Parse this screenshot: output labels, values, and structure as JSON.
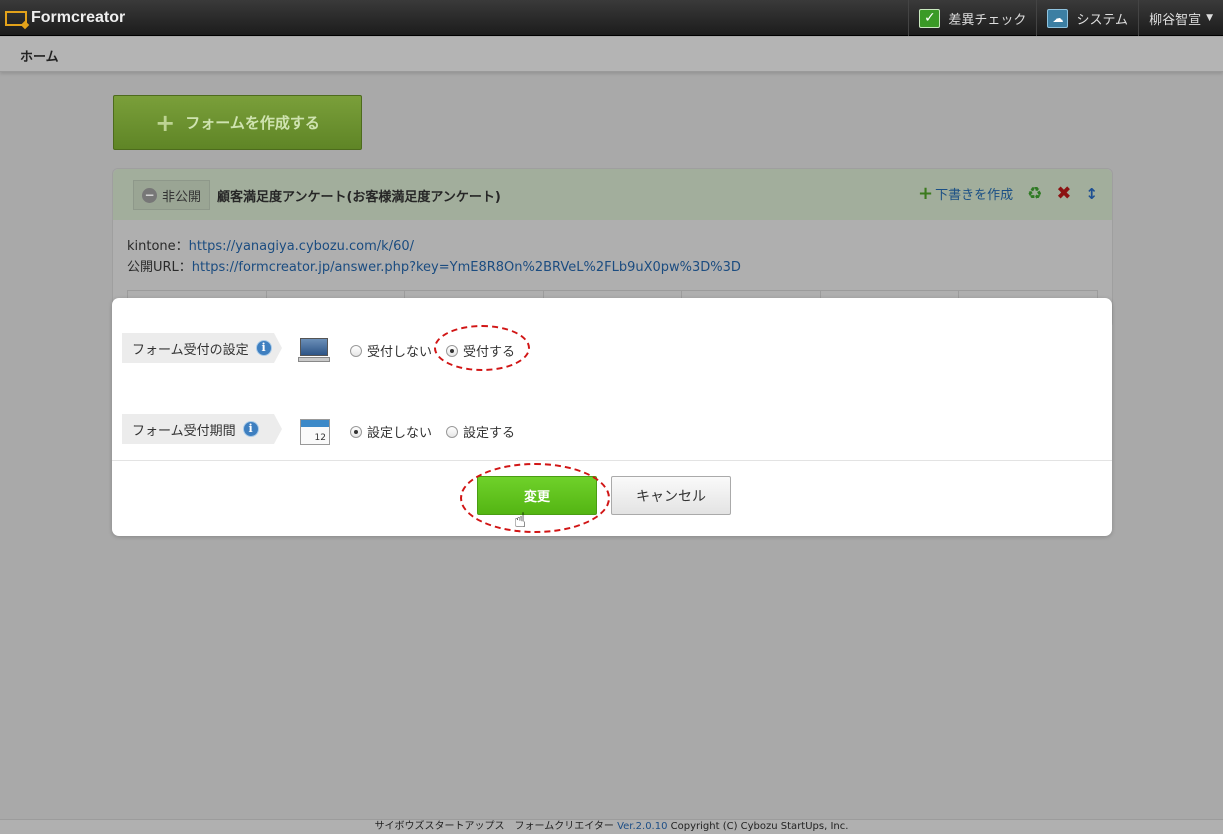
{
  "app": {
    "title": "Formcreator",
    "nav": {
      "diff_check": "差異チェック",
      "system": "システム",
      "user": "柳谷智宣"
    }
  },
  "subbar": {
    "home": "ホーム"
  },
  "create_button": {
    "label": "フォームを作成する"
  },
  "form_panel": {
    "status": "非公開",
    "title": "顧客満足度アンケート(お客様満足度アンケート)",
    "draft_label": "下書きを作成",
    "kintone_label": "kintone：",
    "kintone_url": "https://yanagiya.cybozu.com/k/60/",
    "public_label": "公開URL：",
    "public_url": "https://formcreator.jp/answer.php?key=YmE8R8On%2BRVeL%2FLb9uX0pw%3D%3D"
  },
  "modal": {
    "reception": {
      "label": "フォーム受付の設定",
      "options": [
        "受付しない",
        "受付する"
      ],
      "selected": "受付する"
    },
    "period": {
      "label": "フォーム受付期間",
      "calendar_day": "12",
      "options": [
        "設定しない",
        "設定する"
      ],
      "selected": "設定しない"
    },
    "change_button": "変更",
    "cancel_button": "キャンセル"
  },
  "footer": {
    "company": "サイボウズスタートアップス　フォームクリエイター",
    "version": "Ver.2.0.10",
    "copyright": "Copyright (C) Cybozu StartUps, Inc."
  },
  "colors": {
    "accent_green": "#54b513",
    "highlight_red": "#d11515",
    "link_blue": "#1b4c80"
  }
}
